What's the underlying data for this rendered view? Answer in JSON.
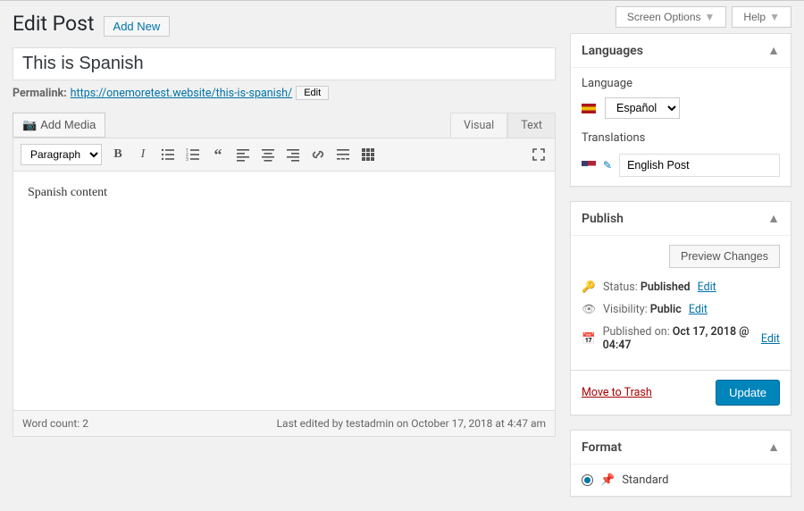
{
  "topbar": {
    "screen_options": "Screen Options",
    "help": "Help"
  },
  "heading": {
    "title": "Edit Post",
    "add_new": "Add New"
  },
  "post": {
    "title": "This is Spanish",
    "permalink_label": "Permalink:",
    "permalink_url": "https://onemoretest.website/this-is-spanish/",
    "permalink_edit": "Edit"
  },
  "editor": {
    "add_media": "Add Media",
    "tab_visual": "Visual",
    "tab_text": "Text",
    "format_select": "Paragraph",
    "content": "Spanish content",
    "word_count_label": "Word count:",
    "word_count": "2",
    "last_edited": "Last edited by testadmin on October 17, 2018 at 4:47 am"
  },
  "languages_panel": {
    "title": "Languages",
    "language_label": "Language",
    "selected_language": "Español",
    "translations_label": "Translations",
    "translation_value": "English Post"
  },
  "publish_panel": {
    "title": "Publish",
    "preview_changes": "Preview Changes",
    "status_label": "Status:",
    "status_value": "Published",
    "status_edit": "Edit",
    "visibility_label": "Visibility:",
    "visibility_value": "Public",
    "visibility_edit": "Edit",
    "published_label": "Published on:",
    "published_value": "Oct 17, 2018 @ 04:47",
    "published_edit": "Edit",
    "trash": "Move to Trash",
    "update": "Update"
  },
  "format_panel": {
    "title": "Format",
    "standard": "Standard"
  }
}
